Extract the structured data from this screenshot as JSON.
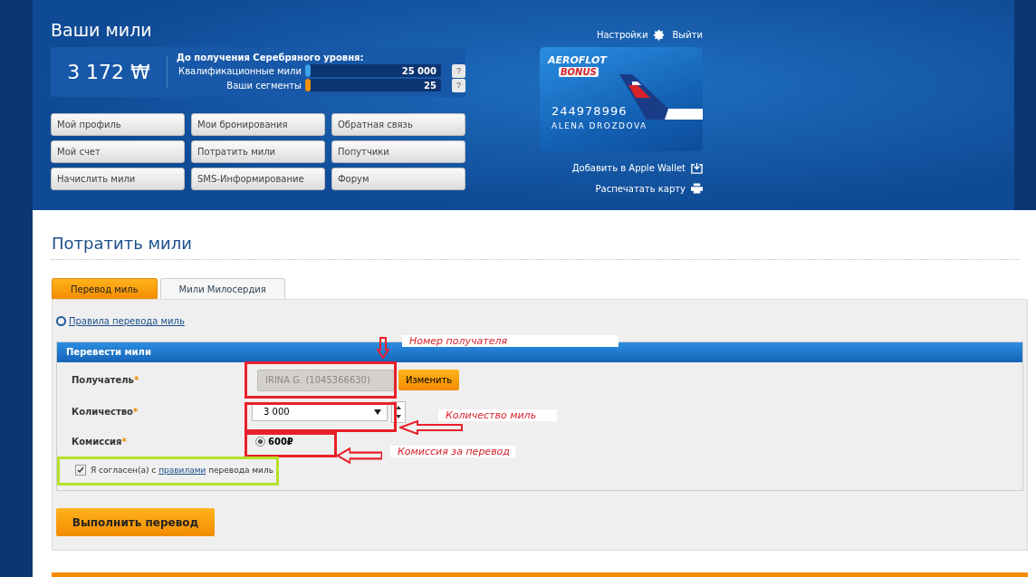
{
  "header": {
    "title": "Ваши мили",
    "balance": "3 172",
    "currency": "₩",
    "settings": "Настройки",
    "logout": "Выйти"
  },
  "progress": {
    "title": "До получения Серебряного уровня:",
    "meters": [
      {
        "label": "Квалификационные мили",
        "level": 0.02,
        "color": "#3aa0e8",
        "reading": "25 000",
        "help": "?"
      },
      {
        "label": "Ваши сегменты",
        "level": 0.02,
        "color": "#f0900c",
        "reading": "25",
        "help": "?"
      }
    ]
  },
  "nav_buttons": [
    "Мой профиль",
    "Мои бронирования",
    "Обратная связь",
    "Мой счет",
    "Потратить мили",
    "Попутчики",
    "Начислить мили",
    "SMS-Информирование",
    "Форум"
  ],
  "card": {
    "brand": "AEROFLOT",
    "program": "BONUS",
    "number": "244978996",
    "holder": "ALENA DROZDOVA"
  },
  "card_links": [
    {
      "label": "Добавить в Apple Wallet",
      "kind": "wallet"
    },
    {
      "label": "Распечатать карту",
      "kind": "print"
    }
  ],
  "page_title": "Потратить мили",
  "tabs": [
    {
      "label": "Перевод миль",
      "selected": true
    },
    {
      "label": "Мили Милосердия",
      "selected": false
    }
  ],
  "rules_link": "Правила перевода миль",
  "form": {
    "title": "Перевести мили",
    "recipient": {
      "label": "Получатель",
      "value": "IRINA G. (1045366630)",
      "disabled": true,
      "button": "Изменить"
    },
    "amount": {
      "label": "Количество",
      "value": "3 000"
    },
    "fee": {
      "label": "Комиссия",
      "value": "600₽",
      "selected": true
    },
    "agree": {
      "checked": true,
      "before": "Я согласен(а) с",
      "link": "правилами",
      "after": "перевода миль"
    },
    "required_mark": "*"
  },
  "submit": "Выполнить перевод",
  "annotations": [
    {
      "kind": "label",
      "text": "Номер получателя"
    },
    {
      "kind": "label",
      "text": "Количество миль"
    },
    {
      "kind": "label",
      "text": "Комиссия за перевод"
    },
    {
      "kind": "frame",
      "color": "#e8202a"
    },
    {
      "kind": "frame",
      "color": "#e8202a"
    },
    {
      "kind": "frame",
      "color": "#e8202a"
    },
    {
      "kind": "frame",
      "color": "#b5e02a"
    },
    {
      "kind": "arrow",
      "color": "#e8202a"
    },
    {
      "kind": "arrow",
      "color": "#e8202a"
    },
    {
      "kind": "arrow",
      "color": "#e8202a"
    }
  ]
}
